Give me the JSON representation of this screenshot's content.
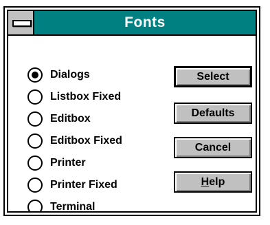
{
  "window": {
    "title": "Fonts"
  },
  "options": [
    {
      "label": "Dialogs",
      "selected": true
    },
    {
      "label": "Listbox Fixed",
      "selected": false
    },
    {
      "label": "Editbox",
      "selected": false
    },
    {
      "label": "Editbox Fixed",
      "selected": false
    },
    {
      "label": "Printer",
      "selected": false
    },
    {
      "label": "Printer Fixed",
      "selected": false
    },
    {
      "label": "Terminal",
      "selected": false
    }
  ],
  "buttons": {
    "select": "Select",
    "defaults": "Defaults",
    "cancel": "Cancel",
    "help_mnemonic": "H",
    "help_rest": "elp"
  },
  "colors": {
    "titlebar": "#008080",
    "button_face": "#c0c0c0"
  }
}
